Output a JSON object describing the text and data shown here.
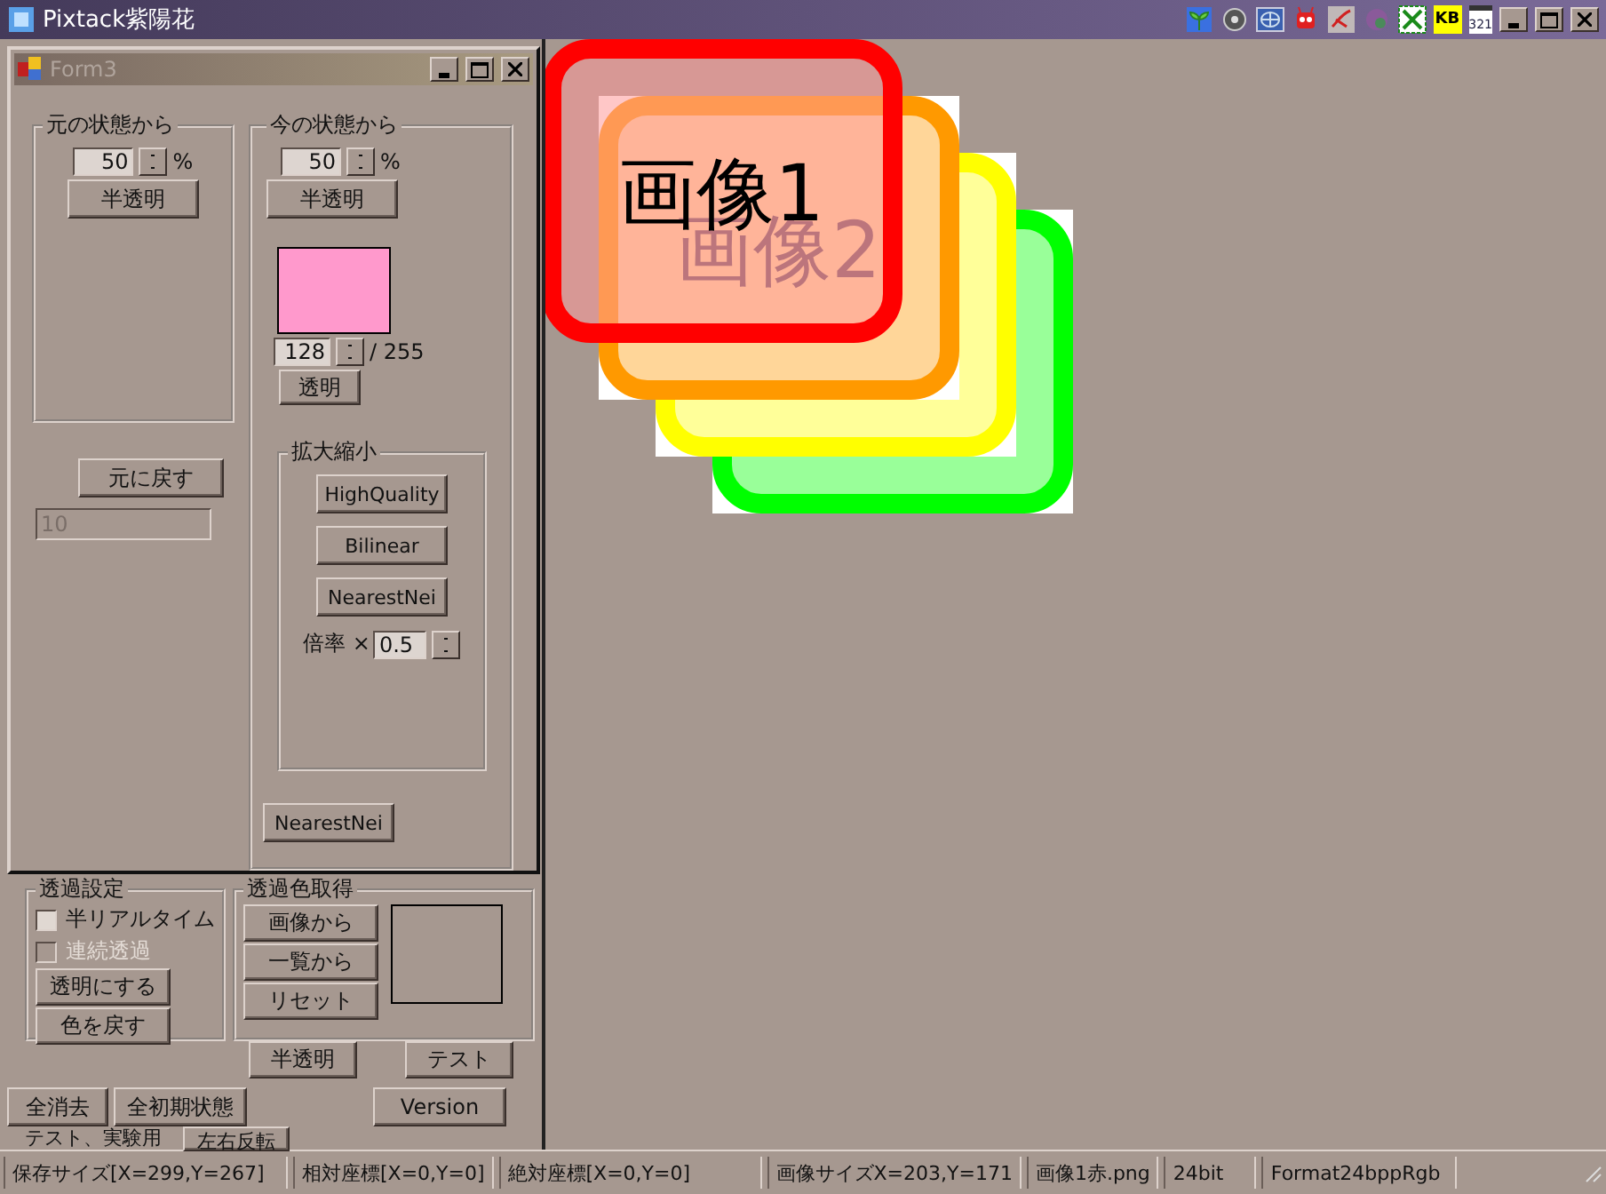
{
  "window": {
    "title": "Pixtack紫陽花",
    "tray_icons": [
      {
        "kind": "sprout"
      },
      {
        "kind": "speaker"
      },
      {
        "kind": "globe"
      },
      {
        "kind": "robot"
      },
      {
        "kind": "brush"
      },
      {
        "kind": "orb"
      },
      {
        "kind": "sheet"
      },
      {
        "kind": "kb",
        "label": "KB"
      },
      {
        "kind": "clapper",
        "label": "321"
      }
    ]
  },
  "form3": {
    "title": "Form3",
    "active": false,
    "from_original": {
      "title": "元の状態から",
      "percent": "50",
      "unit": "%",
      "button": "半透明",
      "reset_button": "元に戻す",
      "text_field": {
        "value": "10",
        "disabled": true
      }
    },
    "from_current": {
      "title": "今の状態から",
      "percent": "50",
      "unit": "%",
      "button": "半透明",
      "swatch": {
        "color": "#ff99cc"
      },
      "alpha": "128",
      "alpha_max": "/ 255",
      "transparent_button": "透明",
      "resize": {
        "title": "拡大縮小",
        "buttons": [
          "HighQuality",
          "Bilinear",
          "NearestNei"
        ],
        "scale_label": "倍率 ×",
        "scale": "0.5"
      },
      "mode_button": "NearestNei"
    }
  },
  "main_panel": {
    "transparency_settings": {
      "title": "透過設定",
      "checkboxes": [
        {
          "label": "半リアルタイム",
          "checked": false,
          "disabled": false
        },
        {
          "label": "連続透過",
          "checked": false,
          "disabled": true
        }
      ],
      "buttons": [
        "透明にする",
        "色を戻す"
      ]
    },
    "transparent_color": {
      "title": "透過色取得",
      "buttons": [
        "画像から",
        "一覧から",
        "リセット"
      ]
    },
    "buttons_row1": [
      "半透明",
      "テスト"
    ],
    "buttons_row2": [
      "全消去",
      "全初期状態",
      "Version"
    ],
    "test_group": {
      "title": "テスト、実験用"
    },
    "flip_button": "左右反転"
  },
  "canvas": {
    "images": [
      {
        "text": "画像1",
        "color": "#ff0000",
        "translucent": true
      },
      {
        "text": "画像2",
        "color": "#ff9900",
        "translucent": false
      },
      {
        "color": "#ffff00",
        "translucent": false
      },
      {
        "color": "#00ff00",
        "translucent": false
      }
    ]
  },
  "status_bar": [
    "保存サイズ[X=299,Y=267]",
    "相対座標[X=0,Y=0]",
    "絶対座標[X=0,Y=0]",
    "画像サイズX=203,Y=171",
    "画像1赤.png",
    "24bit",
    "Format24bppRgb"
  ]
}
